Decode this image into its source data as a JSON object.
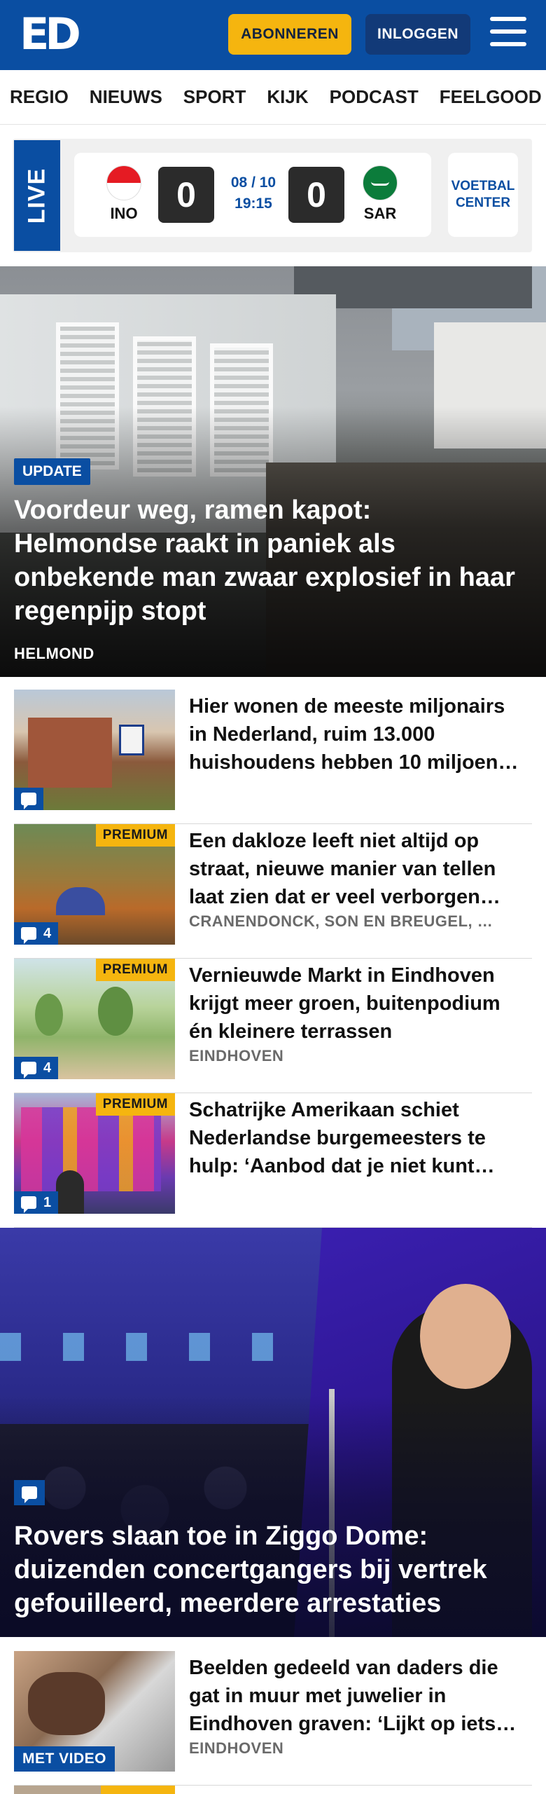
{
  "header": {
    "logo": "ED",
    "subscribe_label": "ABONNEREN",
    "login_label": "INLOGGEN",
    "menu_icon": "hamburger-icon",
    "brand_color": "#0a4ea2",
    "accent_color": "#f5b50f"
  },
  "nav": {
    "items": [
      "REGIO",
      "NIEUWS",
      "SPORT",
      "KIJK",
      "PODCAST",
      "FEELGOOD"
    ]
  },
  "live": {
    "label": "LIVE",
    "home_code": "INO",
    "away_code": "SAR",
    "home_score": "0",
    "away_score": "0",
    "date": "08 / 10",
    "time": "19:15",
    "voetbal_center": "VOETBAL CENTER"
  },
  "hero1": {
    "badge": "UPDATE",
    "title": "Voordeur weg, ramen kapot: Helmondse raakt in paniek als onbekende man zwaar explosief in haar regenpijp stopt",
    "location": "HELMOND"
  },
  "articles": [
    {
      "title": "Hier wonen de meeste miljonairs in Nederland, ruim 13.000 huishoudens hebben 10 miljoen…",
      "location": "",
      "premium": "",
      "comments": ""
    },
    {
      "title": "Een dakloze leeft niet altijd op straat, nieuwe manier van tellen laat zien dat er veel verborgen…",
      "location": "CRANENDONCK, SON EN BREUGEL, …",
      "premium": "PREMIUM",
      "comments": "4"
    },
    {
      "title": "Vernieuwde Markt in Eindhoven krijgt meer groen, buitenpodium én kleinere terrassen",
      "location": "EINDHOVEN",
      "premium": "PREMIUM",
      "comments": "4"
    },
    {
      "title": "Schatrijke Amerikaan schiet Nederlandse burgemeesters te hulp: ‘Aanbod dat je niet kunt…",
      "location": "",
      "premium": "PREMIUM",
      "comments": "1"
    }
  ],
  "hero2": {
    "title": "Rovers slaan toe in Ziggo Dome: duizenden concertgangers bij vertrek gefouilleerd, meerdere arrestaties"
  },
  "article5": {
    "title": "Beelden gedeeld van daders die gat in muur met juwelier in Eindhoven graven: ‘Lijkt op iets…",
    "location": "EINDHOVEN",
    "video_badge": "MET VIDEO"
  }
}
